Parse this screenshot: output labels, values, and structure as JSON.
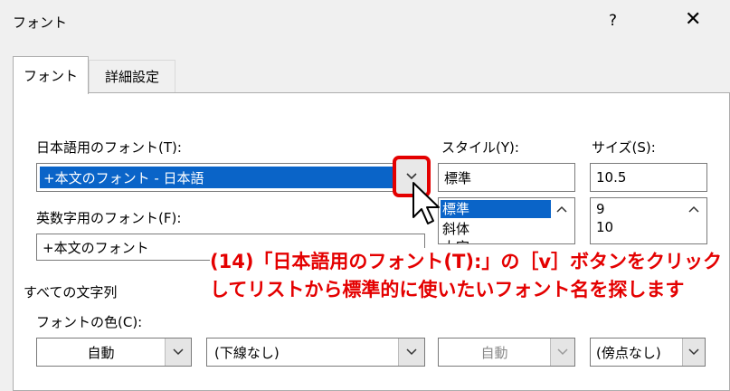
{
  "window": {
    "title": "フォント",
    "help_label": "?",
    "close_label": "✕"
  },
  "tabs": [
    {
      "label": "フォント",
      "active": true
    },
    {
      "label": "詳細設定",
      "active": false
    }
  ],
  "japanese_font": {
    "label": "日本語用のフォント(T):",
    "value": "+本文のフォント - 日本語"
  },
  "latin_font": {
    "label": "英数字用のフォント(F):",
    "value": "+本文のフォント"
  },
  "style": {
    "label": "スタイル(Y):",
    "value": "標準",
    "options": [
      "標準",
      "斜体",
      "太字"
    ]
  },
  "size": {
    "label": "サイズ(S):",
    "value": "10.5",
    "options": [
      "9",
      "10"
    ]
  },
  "all_text": {
    "section_label": "すべての文字列",
    "font_color_label": "フォントの色(C):",
    "font_color_value": "自動",
    "underline_value": "(下線なし)",
    "underline_color_value": "自動",
    "emphasis_value": "(傍点なし)"
  },
  "annotation": {
    "text": "(14)「日本語用のフォント(T):」の［v］ボタンをクリックしてリストから標準的に使いたいフォント名を探します"
  },
  "colors": {
    "highlight": "#0a64c8",
    "annotation_red": "#e40000"
  },
  "icons": [
    "chevron-down-icon",
    "chevron-up-icon",
    "mouse-cursor-icon"
  ]
}
